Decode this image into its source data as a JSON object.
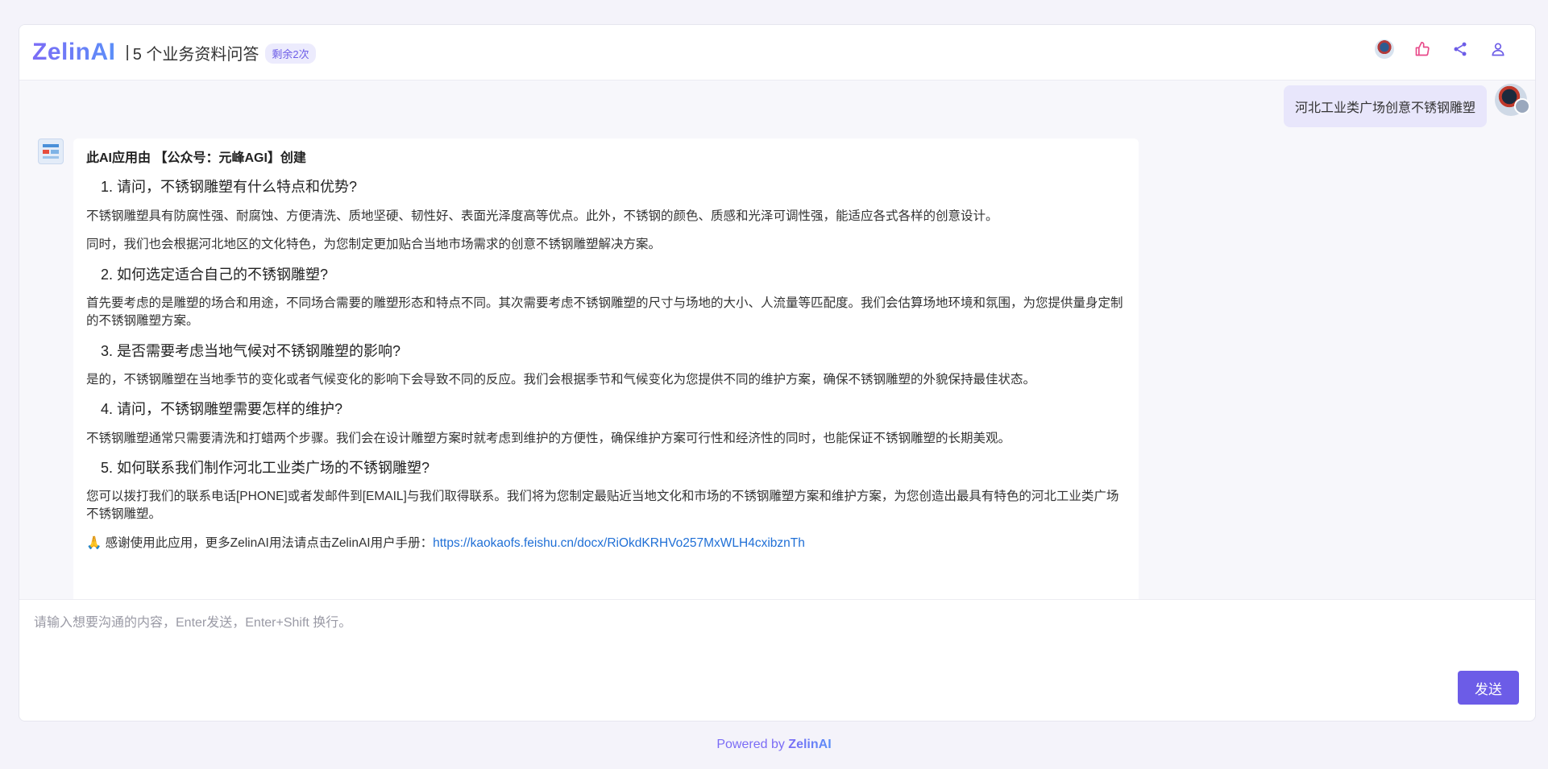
{
  "header": {
    "logo": "ZelinAI",
    "separator": "|",
    "title": "5 个业务资料问答",
    "badge": "剩余2次"
  },
  "icons": {
    "avatar": "user-avatar-icon",
    "like": "thumbs-up-icon",
    "share": "share-icon",
    "user": "user-icon"
  },
  "colors": {
    "accent": "#6c5ce7",
    "like": "#e84a8a"
  },
  "chat": {
    "user_message": "河北工业类广场创意不锈钢雕塑",
    "bot": {
      "intro": "此AI应用由 【公众号：元峰AGI】创建",
      "qa": [
        {
          "q": "1. 请问，不锈钢雕塑有什么特点和优势?",
          "a": [
            "不锈钢雕塑具有防腐性强、耐腐蚀、方便清洗、质地坚硬、韧性好、表面光泽度高等优点。此外，不锈钢的颜色、质感和光泽可调性强，能适应各式各样的创意设计。",
            "同时，我们也会根据河北地区的文化特色，为您制定更加贴合当地市场需求的创意不锈钢雕塑解决方案。"
          ]
        },
        {
          "q": "2. 如何选定适合自己的不锈钢雕塑?",
          "a": [
            "首先要考虑的是雕塑的场合和用途，不同场合需要的雕塑形态和特点不同。其次需要考虑不锈钢雕塑的尺寸与场地的大小、人流量等匹配度。我们会估算场地环境和氛围，为您提供量身定制的不锈钢雕塑方案。"
          ]
        },
        {
          "q": "3. 是否需要考虑当地气候对不锈钢雕塑的影响?",
          "a": [
            "是的，不锈钢雕塑在当地季节的变化或者气候变化的影响下会导致不同的反应。我们会根据季节和气候变化为您提供不同的维护方案，确保不锈钢雕塑的外貌保持最佳状态。"
          ]
        },
        {
          "q": "4. 请问，不锈钢雕塑需要怎样的维护?",
          "a": [
            "不锈钢雕塑通常只需要清洗和打蜡两个步骤。我们会在设计雕塑方案时就考虑到维护的方便性，确保维护方案可行性和经济性的同时，也能保证不锈钢雕塑的长期美观。"
          ]
        },
        {
          "q": "5. 如何联系我们制作河北工业类广场的不锈钢雕塑?",
          "a": [
            "您可以拨打我们的联系电话[PHONE]或者发邮件到[EMAIL]与我们取得联系。我们将为您制定最贴近当地文化和市场的不锈钢雕塑方案和维护方案，为您创造出最具有特色的河北工业类广场不锈钢雕塑。"
          ]
        }
      ],
      "thanks_text": "🙏 感谢使用此应用，更多ZelinAI用法请点击ZelinAI用户手册：",
      "thanks_link": "https://kaokaofs.feishu.cn/docx/RiOkdKRHVo257MxWLH4cxibznTh"
    }
  },
  "input": {
    "placeholder": "请输入想要沟通的内容，Enter发送，Enter+Shift 换行。",
    "value": "",
    "send_label": "发送"
  },
  "footer": {
    "prefix": "Powered by ",
    "brand": "ZelinAI"
  }
}
